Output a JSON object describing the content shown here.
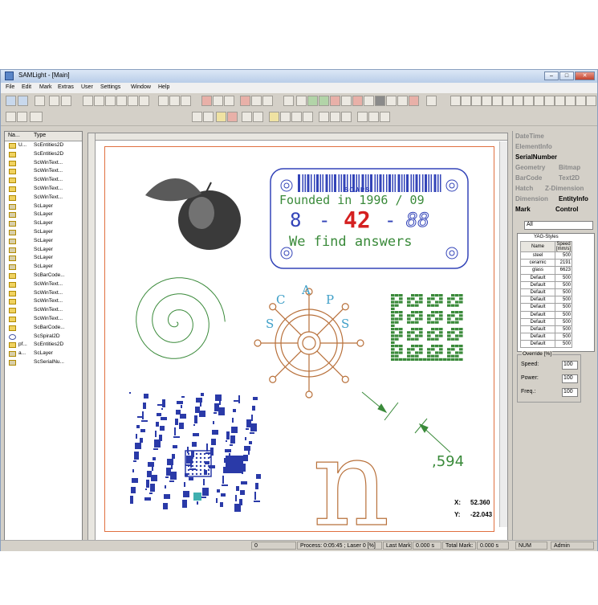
{
  "window": {
    "title": "SAMLight - [Main]",
    "min": "–",
    "max": "□",
    "close": "✕"
  },
  "menu": [
    "File",
    "Edit",
    "Mark",
    "Extras",
    "User",
    "Settings",
    "Window",
    "Help"
  ],
  "tree": {
    "headers": [
      "Na...",
      "Type"
    ],
    "rows": [
      {
        "name": "U...",
        "type": "ScEntities2D",
        "icon": "folder"
      },
      {
        "name": "",
        "type": "ScEntities2D",
        "icon": "folder"
      },
      {
        "name": "",
        "type": "ScWinText...",
        "icon": "folder"
      },
      {
        "name": "",
        "type": "ScWinText...",
        "icon": "folder"
      },
      {
        "name": "",
        "type": "ScWinText...",
        "icon": "folder"
      },
      {
        "name": "",
        "type": "ScWinText...",
        "icon": "folder"
      },
      {
        "name": "",
        "type": "ScWinText...",
        "icon": "folder"
      },
      {
        "name": "",
        "type": "ScLayer",
        "icon": "layer"
      },
      {
        "name": "",
        "type": "ScLayer",
        "icon": "layer"
      },
      {
        "name": "",
        "type": "ScLayer",
        "icon": "layer"
      },
      {
        "name": "",
        "type": "ScLayer",
        "icon": "layer"
      },
      {
        "name": "",
        "type": "ScLayer",
        "icon": "layer"
      },
      {
        "name": "",
        "type": "ScLayer",
        "icon": "layer"
      },
      {
        "name": "",
        "type": "ScLayer",
        "icon": "layer"
      },
      {
        "name": "",
        "type": "ScLayer",
        "icon": "layer"
      },
      {
        "name": "",
        "type": "ScBarCode...",
        "icon": "folder"
      },
      {
        "name": "",
        "type": "ScWinText...",
        "icon": "folder"
      },
      {
        "name": "",
        "type": "ScWinText...",
        "icon": "folder"
      },
      {
        "name": "",
        "type": "ScWinText...",
        "icon": "folder"
      },
      {
        "name": "",
        "type": "ScWinText...",
        "icon": "folder"
      },
      {
        "name": "",
        "type": "ScWinText...",
        "icon": "folder"
      },
      {
        "name": "",
        "type": "ScBarCode...",
        "icon": "folder"
      },
      {
        "name": "",
        "type": "ScSpiral2D",
        "icon": "spiral"
      },
      {
        "name": "pf...",
        "type": "ScEntities2D",
        "icon": "folder"
      },
      {
        "name": "a...",
        "type": "ScLayer",
        "icon": "layer"
      },
      {
        "name": "",
        "type": "ScSerialNu...",
        "icon": "layer"
      }
    ]
  },
  "canvas": {
    "badge": {
      "brand": "SCAPS",
      "line1": "Founded in 1996 / 09",
      "num_left": "8",
      "dash1": "-",
      "num_mid": "42",
      "dash2": "-",
      "num_right": "88",
      "line3": "We find answers"
    },
    "wheel_letters": [
      "S",
      "C",
      "A",
      "P",
      "S"
    ],
    "letter_n": "n",
    "dimension_text": ",594",
    "coord_x_label": "X:",
    "coord_x": "52.360",
    "coord_y_label": "Y:",
    "coord_y": "-22.043"
  },
  "panel": {
    "tabs_row1": [
      "DateTime"
    ],
    "tabs_row2": [
      "ElementInfo"
    ],
    "tabs_row3": [
      "SerialNumber"
    ],
    "tabs_row4": [
      "Geometry",
      "Bitmap"
    ],
    "tabs_row5": [
      "BarCode",
      "Text2D"
    ],
    "tabs_row6": [
      "Hatch",
      "Z-Dimension"
    ],
    "tabs_row7": [
      "Dimension",
      "EntityInfo"
    ],
    "tabs_row8": [
      "Mark",
      "Control"
    ],
    "filter_value": "All",
    "styles_caption": "YAG-Styles",
    "styles_headers": [
      "Name",
      "Speed [mm/s]"
    ],
    "styles": [
      {
        "name": "steel",
        "speed": "500"
      },
      {
        "name": "ceramic",
        "speed": "2191"
      },
      {
        "name": "glass",
        "speed": "6623"
      },
      {
        "name": "Default",
        "speed": "500"
      },
      {
        "name": "Default",
        "speed": "500"
      },
      {
        "name": "Default",
        "speed": "500"
      },
      {
        "name": "Default",
        "speed": "500"
      },
      {
        "name": "Default",
        "speed": "500"
      },
      {
        "name": "Default",
        "speed": "500"
      },
      {
        "name": "Default",
        "speed": "500"
      },
      {
        "name": "Default",
        "speed": "500"
      },
      {
        "name": "Default",
        "speed": "500"
      },
      {
        "name": "Default",
        "speed": "500"
      }
    ],
    "override_caption": "Override [%]",
    "override": [
      {
        "label": "Speed:",
        "value": "100"
      },
      {
        "label": "Power:",
        "value": "100"
      },
      {
        "label": "Freq.:",
        "value": "100"
      }
    ]
  },
  "status": {
    "field0": "0",
    "process": "Process: 0:05:45 ; Laser 0 [%]",
    "last_mark_label": "Last Mark:",
    "last_mark": "0.000 s",
    "total_mark_label": "Total Mark:",
    "total_mark": "0.000 s",
    "num": "NUM",
    "user": "Admin"
  },
  "colors": {
    "accent_blue": "#3344b8",
    "green": "#3a8a3a",
    "red": "#d42020",
    "brown": "#b8703a",
    "cyan": "#40a0c8"
  }
}
